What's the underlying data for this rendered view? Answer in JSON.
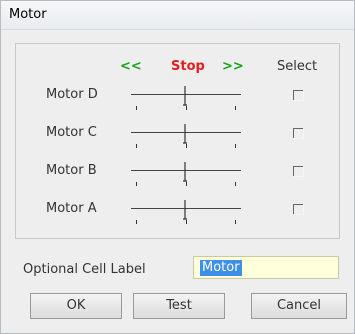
{
  "window": {
    "title": "Motor"
  },
  "motor_panel": {
    "left_label": "<<",
    "stop_label": "Stop",
    "right_label": ">>",
    "select_label": "Select",
    "motors": [
      {
        "name": "Motor D",
        "selected": false,
        "position": 0.5
      },
      {
        "name": "Motor C",
        "selected": false,
        "position": 0.5
      },
      {
        "name": "Motor B",
        "selected": false,
        "position": 0.5
      },
      {
        "name": "Motor A",
        "selected": false,
        "position": 0.5
      }
    ]
  },
  "cell_label": {
    "label": "Optional Cell Label",
    "value": "Motor"
  },
  "buttons": {
    "ok": "OK",
    "test": "Test",
    "cancel": "Cancel"
  },
  "colors": {
    "direction_arrows": "#19a21a",
    "stop": "#e22020",
    "input_background": "#ffffdc",
    "selection": "#3d8fe8"
  }
}
